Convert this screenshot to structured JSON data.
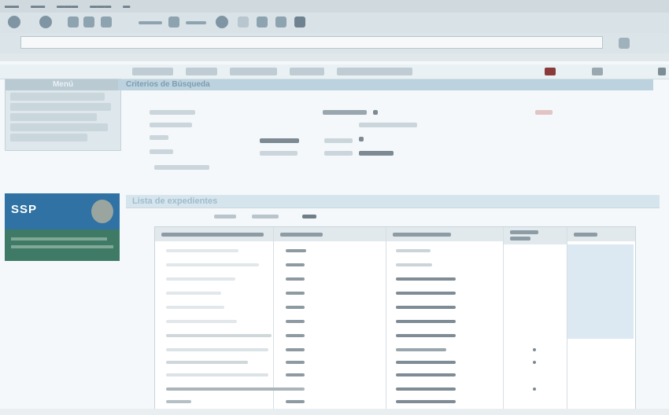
{
  "menubar": {
    "items": [
      "",
      "",
      "",
      "",
      ""
    ]
  },
  "address": {
    "url": ""
  },
  "sidebar": {
    "title": "Menú"
  },
  "banner": {
    "logo_text": "SSP"
  },
  "section1": {
    "title": "Criterios de Búsqueda"
  },
  "section2": {
    "title": "Lista de expedientes"
  },
  "colors": {
    "banner_blue": "#2f72a3",
    "banner_green": "#3f7a66",
    "header_band": "#bcd3df"
  },
  "icons": [
    "back-icon",
    "forward-icon",
    "reload-icon",
    "home-icon",
    "printer-icon",
    "mail-icon"
  ]
}
